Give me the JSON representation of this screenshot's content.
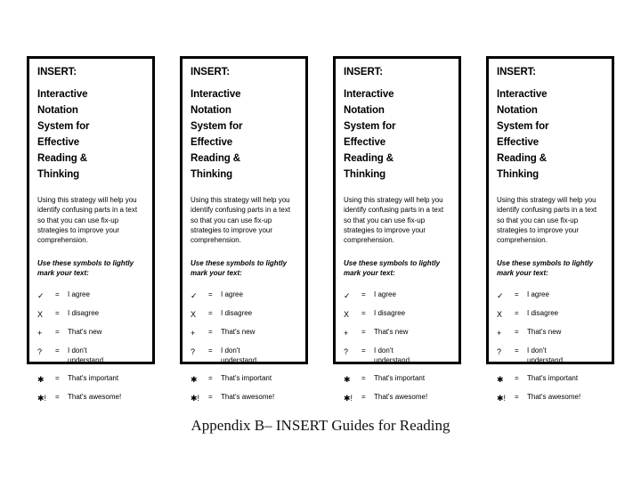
{
  "slide": {
    "background_color": "#ffffff",
    "caption": "Appendix B– INSERT Guides for Reading"
  },
  "card": {
    "border_color": "#000000",
    "title_acronym": "INSERT:",
    "title_lines": [
      "Interactive",
      "Notation",
      "System for",
      "Effective",
      "Reading &",
      "Thinking"
    ],
    "body": "Using this strategy will help you identify confusing parts in a text so that you can use fix-up strategies to improve your comprehension.",
    "instruction": "Use these symbols to lightly mark your text:",
    "equals_sign": "=",
    "symbols": [
      {
        "glyph": "✓",
        "name": "check-symbol",
        "label": "I agree"
      },
      {
        "glyph": "X",
        "name": "x-symbol",
        "label": "I disagree"
      },
      {
        "glyph": "+",
        "name": "plus-symbol",
        "label": "That's new"
      },
      {
        "glyph": "?",
        "name": "question-symbol",
        "label": "I don't\nunderstand"
      },
      {
        "glyph": "✱",
        "name": "asterisk-symbol",
        "label": "That's important"
      },
      {
        "glyph": "✱!",
        "name": "asterisk-exclamation-symbol",
        "label": "That's awesome!"
      }
    ]
  },
  "cards": [
    {
      "index": 1
    },
    {
      "index": 2
    },
    {
      "index": 3
    },
    {
      "index": 4
    }
  ]
}
